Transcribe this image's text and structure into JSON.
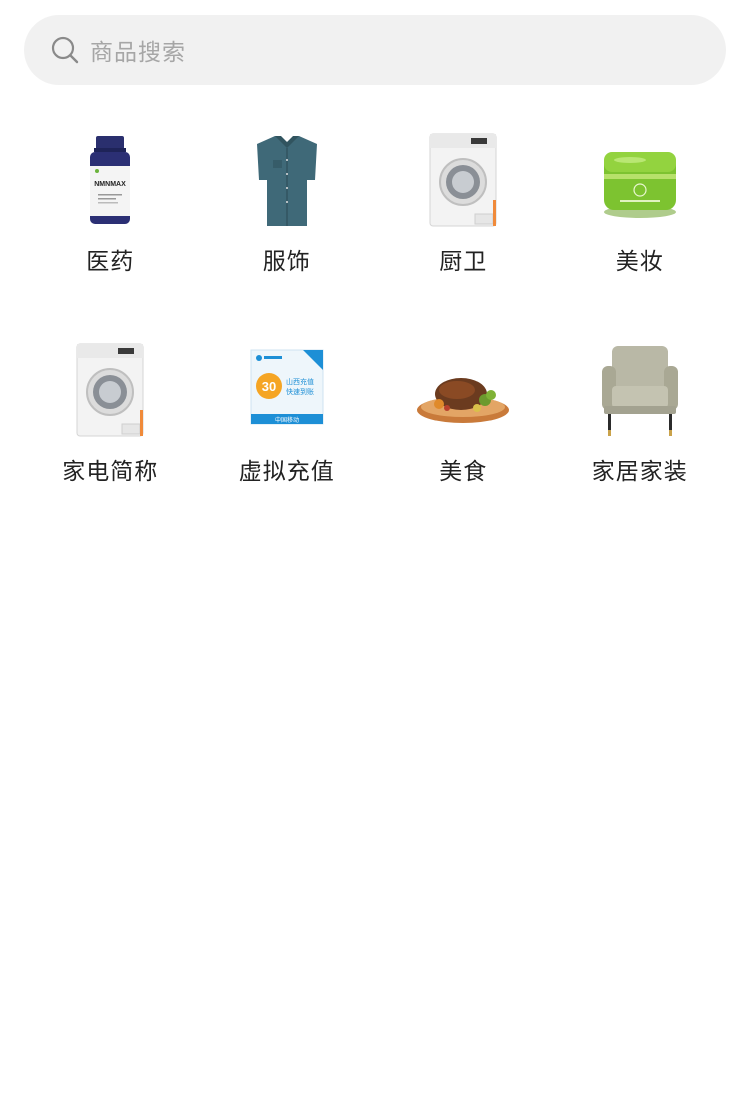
{
  "search": {
    "placeholder": "商品搜索",
    "icon": "search-icon"
  },
  "categories": [
    {
      "label": "医药",
      "icon": "medicine-bottle-image"
    },
    {
      "label": "服饰",
      "icon": "shirt-image"
    },
    {
      "label": "厨卫",
      "icon": "washing-machine-image"
    },
    {
      "label": "美妆",
      "icon": "cosmetic-jar-image"
    },
    {
      "label": "家电简称",
      "icon": "washing-machine-image"
    },
    {
      "label": "虚拟充值",
      "icon": "phone-recharge-card-image"
    },
    {
      "label": "美食",
      "icon": "roast-food-image"
    },
    {
      "label": "家居家装",
      "icon": "armchair-image"
    }
  ],
  "image_text": {
    "bottle_brand": "NMNMAX",
    "recharge_amount": "30",
    "recharge_title": "山西充值",
    "recharge_sub": "快速到账",
    "recharge_operator": "中国移动"
  },
  "colors": {
    "search_bg": "#f1f1f1",
    "placeholder": "#a6a6a6",
    "label": "#222222"
  }
}
